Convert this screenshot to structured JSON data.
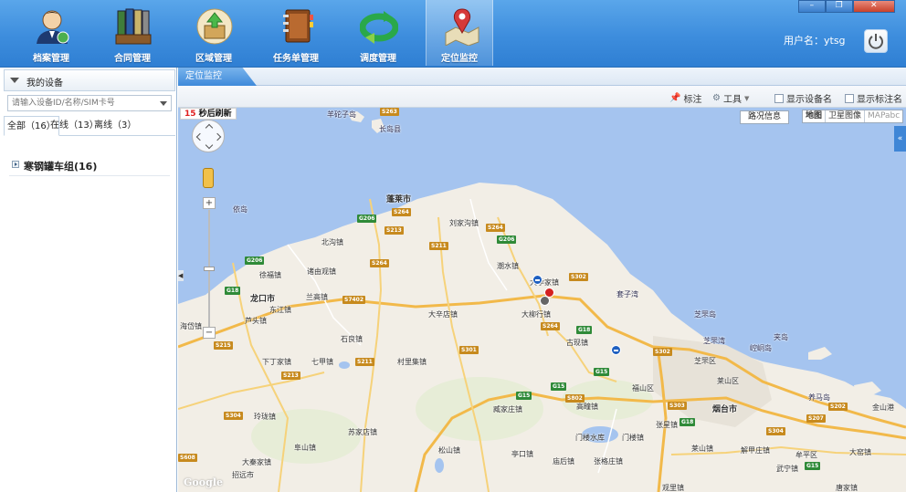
{
  "header": {
    "nav": [
      {
        "label": "档案管理",
        "icon": "user-profile-icon"
      },
      {
        "label": "合同管理",
        "icon": "binders-icon"
      },
      {
        "label": "区域管理",
        "icon": "area-box-icon"
      },
      {
        "label": "任务单管理",
        "icon": "notebook-icon"
      },
      {
        "label": "调度管理",
        "icon": "dispatch-arrows-icon"
      },
      {
        "label": "定位监控",
        "icon": "map-pin-icon"
      }
    ],
    "active_nav": "定位监控",
    "user_label": "用户名：ytsg"
  },
  "left_panel": {
    "title": "我的设备",
    "search_placeholder": "请输入设备ID/名称/SIM卡号",
    "tabs": [
      {
        "label": "全部（16）"
      },
      {
        "label": "在线（13）"
      },
      {
        "label": "离线（3）"
      }
    ],
    "group": {
      "label": "寒钢罐车组(16)"
    }
  },
  "main": {
    "tab_label": "定位监控",
    "toolbar": {
      "mark_label": "标注",
      "tools_label": "工具",
      "show_device_name": "显示设备名",
      "show_mark_name": "显示标注名"
    }
  },
  "map": {
    "refresh_seconds": "15",
    "refresh_text": "秒后刷新",
    "traffic_button": "路况信息",
    "map_types": [
      "地图",
      "卫星图像",
      "MAPabc"
    ],
    "google_logo": "Google",
    "places": [
      {
        "name": "羊砣子岛",
        "cls": "sea"
      },
      {
        "name": "长岛县",
        "cls": "sea"
      },
      {
        "name": "依岛",
        "cls": "sea"
      },
      {
        "name": "蓬莱市",
        "cls": "big"
      },
      {
        "name": "刘家沟镇",
        "cls": ""
      },
      {
        "name": "北沟镇",
        "cls": ""
      },
      {
        "name": "诸由观镇",
        "cls": ""
      },
      {
        "name": "徐福镇",
        "cls": ""
      },
      {
        "name": "龙口市",
        "cls": "big"
      },
      {
        "name": "东江镇",
        "cls": ""
      },
      {
        "name": "兰高镇",
        "cls": ""
      },
      {
        "name": "芦头镇",
        "cls": ""
      },
      {
        "name": "海岱镇",
        "cls": ""
      },
      {
        "name": "潮水镇",
        "cls": ""
      },
      {
        "name": "大季家镇",
        "cls": ""
      },
      {
        "name": "大柳行镇",
        "cls": ""
      },
      {
        "name": "大辛店镇",
        "cls": ""
      },
      {
        "name": "石良镇",
        "cls": ""
      },
      {
        "name": "下丁家镇",
        "cls": ""
      },
      {
        "name": "七甲镇",
        "cls": ""
      },
      {
        "name": "村里集镇",
        "cls": ""
      },
      {
        "name": "古现镇",
        "cls": ""
      },
      {
        "name": "套子湾",
        "cls": "sea"
      },
      {
        "name": "芝罘岛",
        "cls": "sea"
      },
      {
        "name": "芝罘湾",
        "cls": "sea"
      },
      {
        "name": "崆峒岛",
        "cls": "sea"
      },
      {
        "name": "夹岛",
        "cls": "sea"
      },
      {
        "name": "芝罘区",
        "cls": ""
      },
      {
        "name": "莱山区",
        "cls": ""
      },
      {
        "name": "福山区",
        "cls": ""
      },
      {
        "name": "烟台市",
        "cls": "big"
      },
      {
        "name": "养马岛",
        "cls": "sea"
      },
      {
        "name": "金山港",
        "cls": ""
      },
      {
        "name": "高疃镇",
        "cls": ""
      },
      {
        "name": "臧家庄镇",
        "cls": ""
      },
      {
        "name": "门楼水库",
        "cls": ""
      },
      {
        "name": "门楼镇",
        "cls": ""
      },
      {
        "name": "张星镇",
        "cls": ""
      },
      {
        "name": "玲珑镇",
        "cls": ""
      },
      {
        "name": "苏家店镇",
        "cls": ""
      },
      {
        "name": "阜山镇",
        "cls": ""
      },
      {
        "name": "大秦家镇",
        "cls": ""
      },
      {
        "name": "招远市",
        "cls": ""
      },
      {
        "name": "松山镇",
        "cls": ""
      },
      {
        "name": "亭口镇",
        "cls": ""
      },
      {
        "name": "庙后镇",
        "cls": ""
      },
      {
        "name": "张格庄镇",
        "cls": ""
      },
      {
        "name": "莱山镇",
        "cls": ""
      },
      {
        "name": "解甲庄镇",
        "cls": ""
      },
      {
        "name": "牟平区",
        "cls": ""
      },
      {
        "name": "武宁镇",
        "cls": ""
      },
      {
        "name": "大窑镇",
        "cls": ""
      },
      {
        "name": "观里镇",
        "cls": ""
      },
      {
        "name": "唐家镇",
        "cls": ""
      }
    ],
    "roads": [
      "S263",
      "G206",
      "S264",
      "S213",
      "S211",
      "S264",
      "G206",
      "G206",
      "S264",
      "G18",
      "S7402",
      "S302",
      "S264",
      "G18",
      "S215",
      "S213",
      "S211",
      "S301",
      "G15",
      "S302",
      "G15",
      "S802",
      "G15",
      "S303",
      "G18",
      "S304",
      "S608",
      "S304",
      "S207",
      "S202",
      "G15"
    ]
  }
}
